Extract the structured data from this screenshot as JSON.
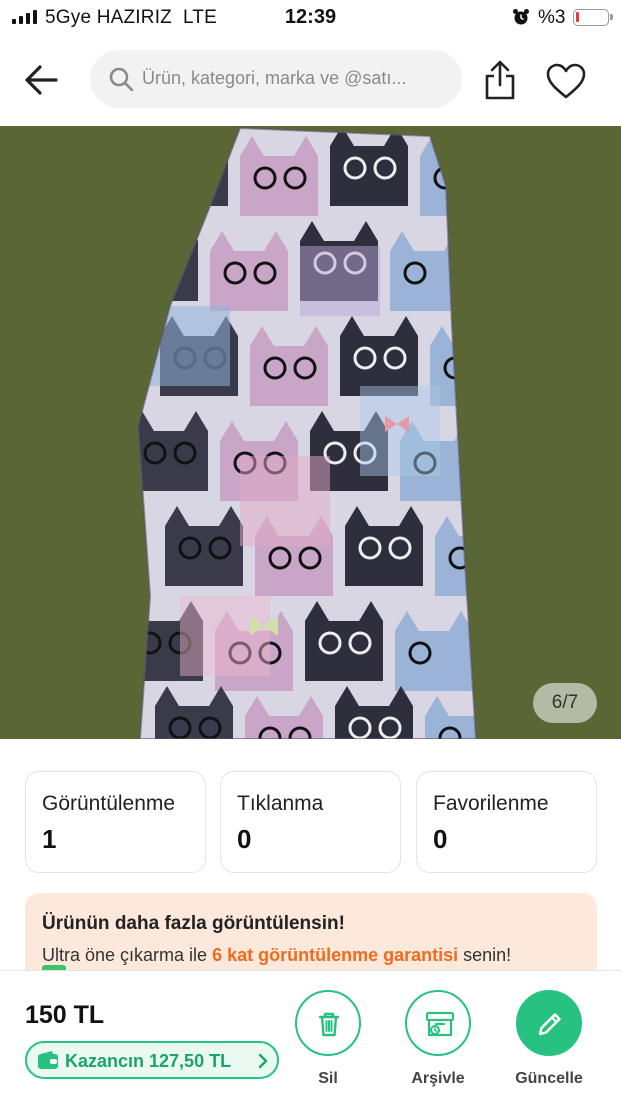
{
  "status_bar": {
    "carrier": "5Gye HAZIRIZ",
    "network": "LTE",
    "time": "12:39",
    "battery": "%3"
  },
  "header": {
    "search_placeholder": "Ürün, kategori, marka ve @satı..."
  },
  "gallery": {
    "counter": "6/7",
    "current": 6,
    "total": 7
  },
  "stats": [
    {
      "label": "Görüntülenme",
      "value": "1"
    },
    {
      "label": "Tıklanma",
      "value": "0"
    },
    {
      "label": "Favorilenme",
      "value": "0"
    }
  ],
  "promo": {
    "title": "Ürünün daha fazla görüntülensin!",
    "desc_prefix": "Ultra öne çıkarma ile ",
    "desc_highlight": "6 kat görüntülenme garantisi",
    "desc_suffix": " senin!"
  },
  "bottom_bar": {
    "price": "150 TL",
    "earnings": "Kazancın 127,50 TL",
    "actions": {
      "delete": "Sil",
      "archive": "Arşivle",
      "update": "Güncelle"
    }
  },
  "colors": {
    "accent": "#27c281",
    "highlight": "#f26a1b",
    "promo_bg": "#fde9dc",
    "photo_bg": "#5e6a37"
  }
}
